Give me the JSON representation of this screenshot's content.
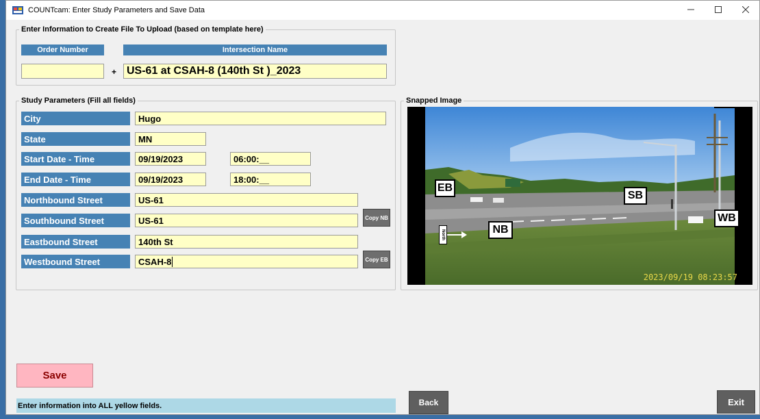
{
  "window": {
    "title": "COUNTcam:  Enter Study Parameters and Save Data",
    "controls": {
      "minimize": "—",
      "maximize": "☐",
      "close": "✕"
    }
  },
  "file_section": {
    "legend": "Enter Information to Create File To Upload (based on template here)",
    "order_number_label": "Order Number",
    "order_number_value": "",
    "separator": "+",
    "intersection_label": "Intersection Name",
    "intersection_value": "US-61 at CSAH-8 (140th St )_2023"
  },
  "study": {
    "legend": "Study Parameters (Fill all fields)",
    "city_label": "City",
    "city_value": "Hugo",
    "state_label": "State",
    "state_value": "MN",
    "start_label": "Start Date - Time",
    "start_date": "09/19/2023",
    "start_time": "06:00:__",
    "end_label": "End Date - Time",
    "end_date": "09/19/2023",
    "end_time": "18:00:__",
    "nb_label": "Northbound Street",
    "nb_value": "US-61",
    "sb_label": "Southbound Street",
    "sb_value": "US-61",
    "copy_nb_label": "Copy NB",
    "eb_label": "Eastbound Street",
    "eb_value": "140th St",
    "wb_label": "Westbound Street",
    "wb_value": "CSAH-8",
    "copy_eb_label": "Copy EB"
  },
  "snapped": {
    "legend": "Snapped Image",
    "labels": {
      "eb": "EB",
      "sb": "SB",
      "nb": "NB",
      "wb": "WB",
      "north": "North"
    },
    "timestamp": "2023/09/19  08:23:57"
  },
  "actions": {
    "save_label": "Save",
    "status_text": "Enter information into ALL yellow fields.",
    "back_label": "Back",
    "exit_label": "Exit"
  },
  "colors": {
    "field_yellow": "#ffffc6",
    "label_blue": "#4682b4",
    "save_pink": "#ffb6c1",
    "status_blue": "#add8e6",
    "button_gray": "#5f5f5f"
  }
}
